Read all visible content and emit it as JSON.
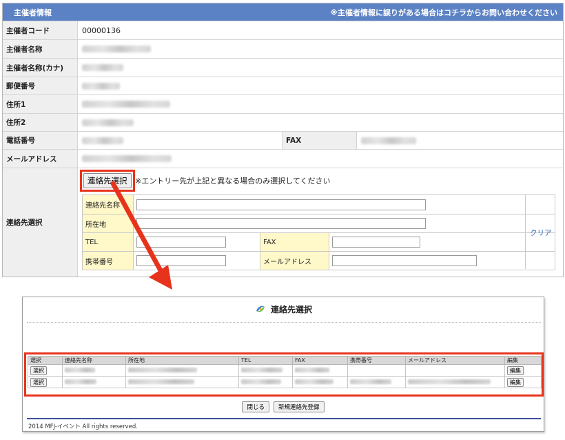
{
  "organizer": {
    "header_title": "主催者情報",
    "header_link": "※主催者情報に誤りがある場合はコチラからお問い合わせください",
    "labels": {
      "code": "主催者コード",
      "name": "主催者名称",
      "name_kana": "主催者名称(カナ)",
      "postal": "郵便番号",
      "address1": "住所1",
      "address2": "住所2",
      "phone": "電話番号",
      "fax": "FAX",
      "email": "メールアドレス",
      "contact_select": "連絡先選択"
    },
    "values": {
      "code": "00000136"
    }
  },
  "contact_form": {
    "select_button": "連絡先選択",
    "note": "※エントリー先が上記と異なる場合のみ選択してください",
    "fields": {
      "name": "連絡先名称",
      "address": "所在地",
      "tel": "TEL",
      "fax": "FAX",
      "mobile": "携帯番号",
      "email": "メールアドレス"
    },
    "clear_link": "クリア"
  },
  "popup": {
    "title": "連絡先選択",
    "columns": [
      "選択",
      "連絡先名称",
      "所在地",
      "TEL",
      "FAX",
      "携帯番号",
      "メールアドレス",
      "編集"
    ],
    "rows": [
      {
        "select_label": "選択",
        "edit_label": "編集"
      },
      {
        "select_label": "選択",
        "edit_label": "編集"
      }
    ],
    "close_button": "閉じる",
    "new_button": "新規連絡先登録",
    "footer": "2014 MFJ-イベント All rights reserved."
  },
  "colors": {
    "header_blue": "#5b82c4",
    "highlight_red": "#e8331c",
    "label_yellow": "#fff8c9",
    "link_blue": "#2e67b5"
  },
  "icons": {
    "popup_logo": "swirl-logo-icon",
    "callout_arrow": "arrow-down-left-icon"
  }
}
